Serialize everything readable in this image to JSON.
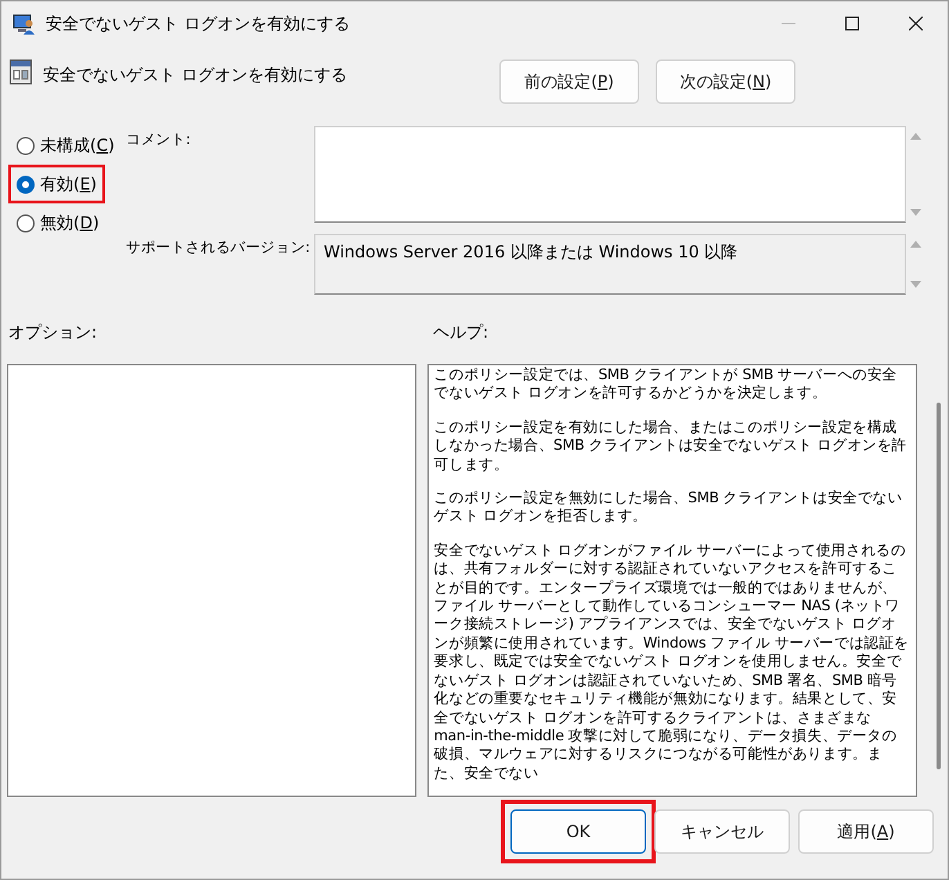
{
  "window": {
    "title": "安全でないゲスト ログオンを有効にする"
  },
  "header": {
    "title": "安全でないゲスト ログオンを有効にする",
    "buttons": [
      {
        "label": "前の設定(P)"
      },
      {
        "label": "次の設定(N)"
      }
    ]
  },
  "state_options": [
    {
      "label": "未構成(C)",
      "selected": false,
      "highlighted": false
    },
    {
      "label": "有効(E)",
      "selected": true,
      "highlighted": true
    },
    {
      "label": "無効(D)",
      "selected": false,
      "highlighted": false
    }
  ],
  "comment": {
    "label": "コメント:"
  },
  "supported": {
    "label": "サポートされるバージョン:",
    "value": "Windows Server 2016 以降または Windows 10 以降"
  },
  "options": {
    "label": "オプション:"
  },
  "help": {
    "label": "ヘルプ:",
    "paragraphs": [
      "このポリシー設定では、SMB クライアントが SMB サーバーへの安全でないゲスト ログオンを許可するかどうかを決定します。",
      "このポリシー設定を有効にした場合、またはこのポリシー設定を構成しなかった場合、SMB クライアントは安全でないゲスト ログオンを許可します。",
      "このポリシー設定を無効にした場合、SMB クライアントは安全でないゲスト ログオンを拒否します。",
      "安全でないゲスト ログオンがファイル サーバーによって使用されるのは、共有フォルダーに対する認証されていないアクセスを許可することが目的です。エンタープライズ環境では一般的ではありませんが、ファイル サーバーとして動作しているコンシューマー NAS (ネットワーク接続ストレージ) アプライアンスでは、安全でないゲスト ログオンが頻繁に使用されています。Windows ファイル サーバーでは認証を要求し、既定では安全でないゲスト ログオンを使用しません。安全でないゲスト ログオンは認証されていないため、SMB 署名、SMB 暗号化などの重要なセキュリティ機能が無効になります。結果として、安全でないゲスト ログオンを許可するクライアントは、さまざまな man-in-the-middle 攻撃に対して脆弱になり、データ損失、データの破損、マルウェアに対するリスクにつながる可能性があります。また、安全でない"
    ]
  },
  "footer_buttons": [
    {
      "label": "OK",
      "default": true,
      "highlighted": true
    },
    {
      "label": "キャンセル",
      "default": false,
      "highlighted": false
    },
    {
      "label": "適用(A)",
      "default": false,
      "highlighted": false
    }
  ]
}
